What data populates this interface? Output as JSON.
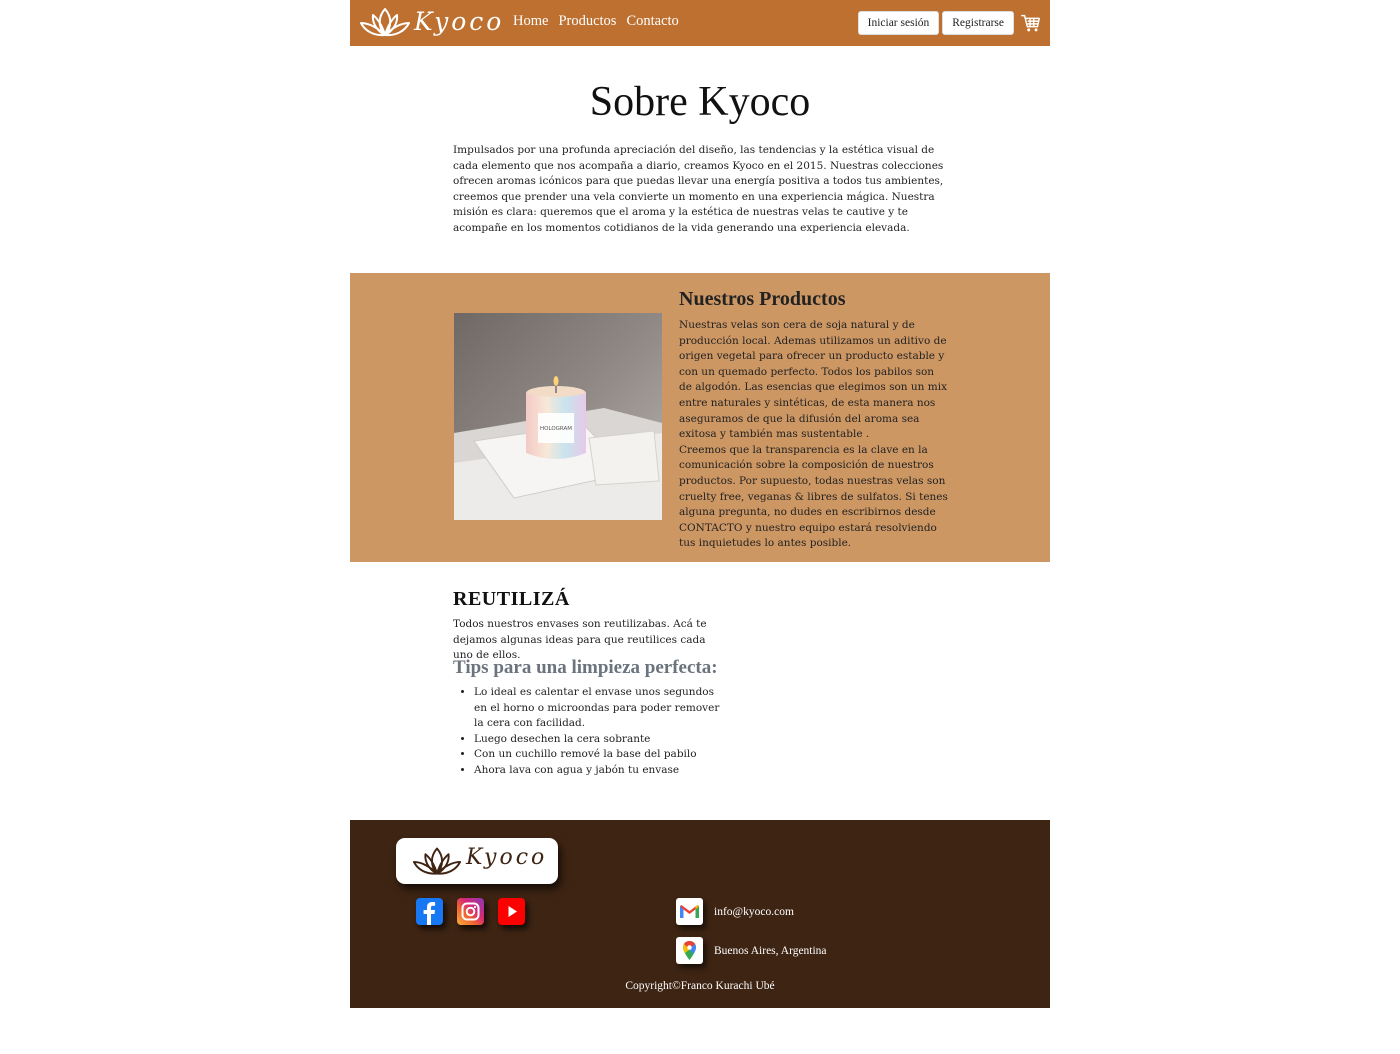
{
  "brand": {
    "name": "Kyoco",
    "logo_icon": "lotus-icon"
  },
  "nav": {
    "links": [
      "Home",
      "Productos",
      "Contacto"
    ],
    "login_label": "Iniciar sesión",
    "register_label": "Registrarse",
    "cart_icon": "cart-icon"
  },
  "about": {
    "title": "Sobre Kyoco",
    "text": "Impulsados por una profunda apreciación del diseño, las tendencias y la estética visual de cada elemento que nos acompaña a diario, creamos Kyoco en el 2015. Nuestras colecciones ofrecen aromas icónicos para que puedas llevar una energía positiva a todos tus ambientes, creemos que prender una vela convierte un momento en una experiencia mágica. Nuestra misión es clara: queremos que el aroma y la estética de nuestras velas te cautive y te acompañe en los momentos cotidianos de la vida generando una experiencia elevada."
  },
  "products": {
    "title": "Nuestros Productos",
    "paragraph_1": "Nuestras velas son cera de soja natural y de producción local. Ademas utilizamos un aditivo de origen vegetal para ofrecer un producto estable y con un quemado perfecto. Todos los pabilos son de algodón. Las esencias que elegimos son un mix entre naturales y sintéticas, de esta manera nos aseguramos de que la difusión del aroma sea exitosa y también mas sustentable .",
    "paragraph_2": "Creemos que la transparencia es la clave en la comunicación sobre la composición de nuestros productos. Por supuesto, todas nuestras velas son cruelty free, veganas & libres de sulfatos. Si tenes alguna pregunta, no dudes en escribirnos desde CONTACTO y nuestro equipo estará resolviendo tus inquietudes lo antes posible.",
    "image_label": "HOLOGRAM"
  },
  "reuse": {
    "title": "REUTILIZÁ",
    "text": "Todos nuestros envases son reutilizabas. Acá te dejamos algunas ideas para que reutilices cada uno de ellos.",
    "tips_title": "Tips para una limpieza perfecta:",
    "tips": [
      "Lo ideal es calentar el envase unos segundos en el horno o microondas para poder remover la cera con facilidad.",
      "Luego desechen la cera sobrante",
      "Con un cuchillo remové la base del pabilo",
      "Ahora lava con agua y jabón tu envase"
    ]
  },
  "footer": {
    "brand": "Kyoco",
    "social_icons": [
      "facebook-icon",
      "instagram-icon",
      "youtube-icon"
    ],
    "email": "info@kyoco.com",
    "location": "Buenos Aires, Argentina",
    "copyright": "Copyright©Franco Kurachi Ubé"
  },
  "colors": {
    "navbar": "#bd7030",
    "products_band": "#cd9764",
    "footer": "#3e2413"
  }
}
